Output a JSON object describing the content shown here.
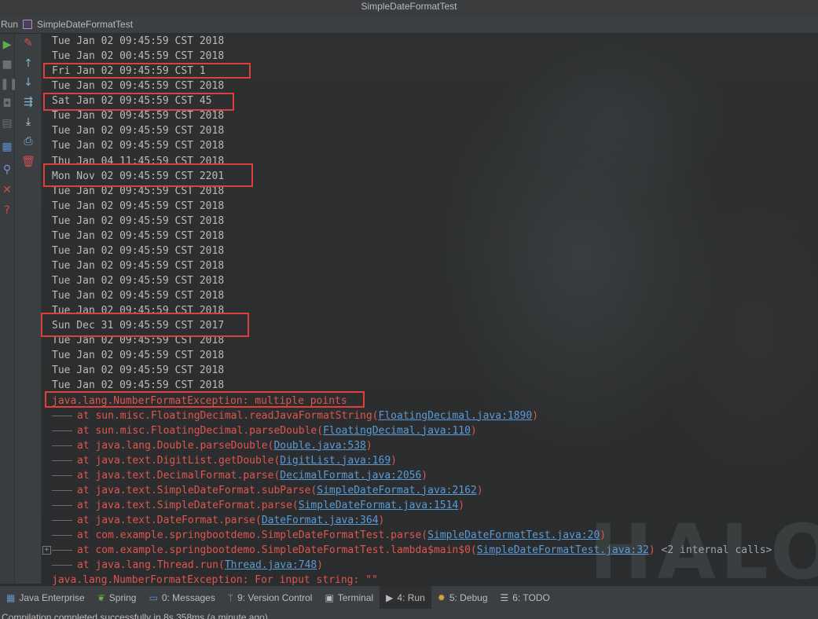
{
  "window": {
    "title": "SimpleDateFormatTest"
  },
  "run_tab": {
    "prefix": "Run",
    "config": "SimpleDateFormatTest"
  },
  "console": {
    "date_lines": [
      "Tue Jan 02 09:45:59 CST 2018",
      "Tue Jan 02 00:45:59 CST 2018",
      "Fri Jan 02 09:45:59 CST 1",
      "Tue Jan 02 09:45:59 CST 2018",
      "Sat Jan 02 09:45:59 CST 45",
      "Tue Jan 02 09:45:59 CST 2018",
      "Tue Jan 02 09:45:59 CST 2018",
      "Tue Jan 02 09:45:59 CST 2018",
      "Thu Jan 04 11:45:59 CST 2018",
      "Mon Nov 02 09:45:59 CST 2201",
      "Tue Jan 02 09:45:59 CST 2018",
      "Tue Jan 02 09:45:59 CST 2018",
      "Tue Jan 02 09:45:59 CST 2018",
      "Tue Jan 02 09:45:59 CST 2018",
      "Tue Jan 02 09:45:59 CST 2018",
      "Tue Jan 02 09:45:59 CST 2018",
      "Tue Jan 02 09:45:59 CST 2018",
      "Tue Jan 02 09:45:59 CST 2018",
      "Tue Jan 02 09:45:59 CST 2018",
      "Sun Dec 31 09:45:59 CST 2017",
      "Tue Jan 02 09:45:59 CST 2018",
      "Tue Jan 02 09:45:59 CST 2018",
      "Tue Jan 02 09:45:59 CST 2018",
      "Tue Jan 02 09:45:59 CST 2018"
    ],
    "exception1": "java.lang.NumberFormatException: multiple points",
    "trace": [
      {
        "text": "at sun.misc.FloatingDecimal.readJavaFormatString(",
        "link": "FloatingDecimal.java:1890",
        "tail": ")",
        "extra": ""
      },
      {
        "text": "at sun.misc.FloatingDecimal.parseDouble(",
        "link": "FloatingDecimal.java:110",
        "tail": ")",
        "extra": ""
      },
      {
        "text": "at java.lang.Double.parseDouble(",
        "link": "Double.java:538",
        "tail": ")",
        "extra": ""
      },
      {
        "text": "at java.text.DigitList.getDouble(",
        "link": "DigitList.java:169",
        "tail": ")",
        "extra": ""
      },
      {
        "text": "at java.text.DecimalFormat.parse(",
        "link": "DecimalFormat.java:2056",
        "tail": ")",
        "extra": ""
      },
      {
        "text": "at java.text.SimpleDateFormat.subParse(",
        "link": "SimpleDateFormat.java:2162",
        "tail": ")",
        "extra": ""
      },
      {
        "text": "at java.text.SimpleDateFormat.parse(",
        "link": "SimpleDateFormat.java:1514",
        "tail": ")",
        "extra": ""
      },
      {
        "text": "at java.text.DateFormat.parse(",
        "link": "DateFormat.java:364",
        "tail": ")",
        "extra": ""
      },
      {
        "text": "at com.example.springbootdemo.SimpleDateFormatTest.parse(",
        "link": "SimpleDateFormatTest.java:20",
        "tail": ")",
        "extra": ""
      },
      {
        "text": "at com.example.springbootdemo.SimpleDateFormatTest.lambda$main$0(",
        "link": "SimpleDateFormatTest.java:32",
        "tail": ")",
        "extra": " <2 internal calls>"
      },
      {
        "text": "at java.lang.Thread.run(",
        "link": "Thread.java:748",
        "tail": ")",
        "extra": ""
      }
    ],
    "exception2": "java.lang.NumberFormatException: For input string: \"\""
  },
  "bottom_tools": [
    {
      "icon": "java-enterprise-icon",
      "glyph": "▦",
      "color": "#6a8fc8",
      "label": "Java Enterprise"
    },
    {
      "icon": "spring-icon",
      "glyph": "❦",
      "color": "#6cad4a",
      "label": "Spring"
    },
    {
      "icon": "messages-icon",
      "glyph": "▭",
      "color": "#5b8fd6",
      "label": "0: Messages"
    },
    {
      "icon": "version-control-icon",
      "glyph": "ᛘ",
      "color": "#9aa0a6",
      "label": "9: Version Control"
    },
    {
      "icon": "terminal-icon",
      "glyph": "▣",
      "color": "#bbbbbb",
      "label": "Terminal"
    },
    {
      "icon": "run-icon",
      "glyph": "▶",
      "color": "#bbbbbb",
      "label": "4: Run"
    },
    {
      "icon": "debug-icon",
      "glyph": "✹",
      "color": "#d9a441",
      "label": "5: Debug"
    },
    {
      "icon": "todo-icon",
      "glyph": "☰",
      "color": "#bbbbbb",
      "label": "6: TODO"
    }
  ],
  "status": {
    "text": "Compilation completed successfully in 8s 358ms (a minute ago)"
  },
  "colors": {
    "highlight": "#e03e3e",
    "error": "#e0554f",
    "link": "#5b9bd5"
  }
}
